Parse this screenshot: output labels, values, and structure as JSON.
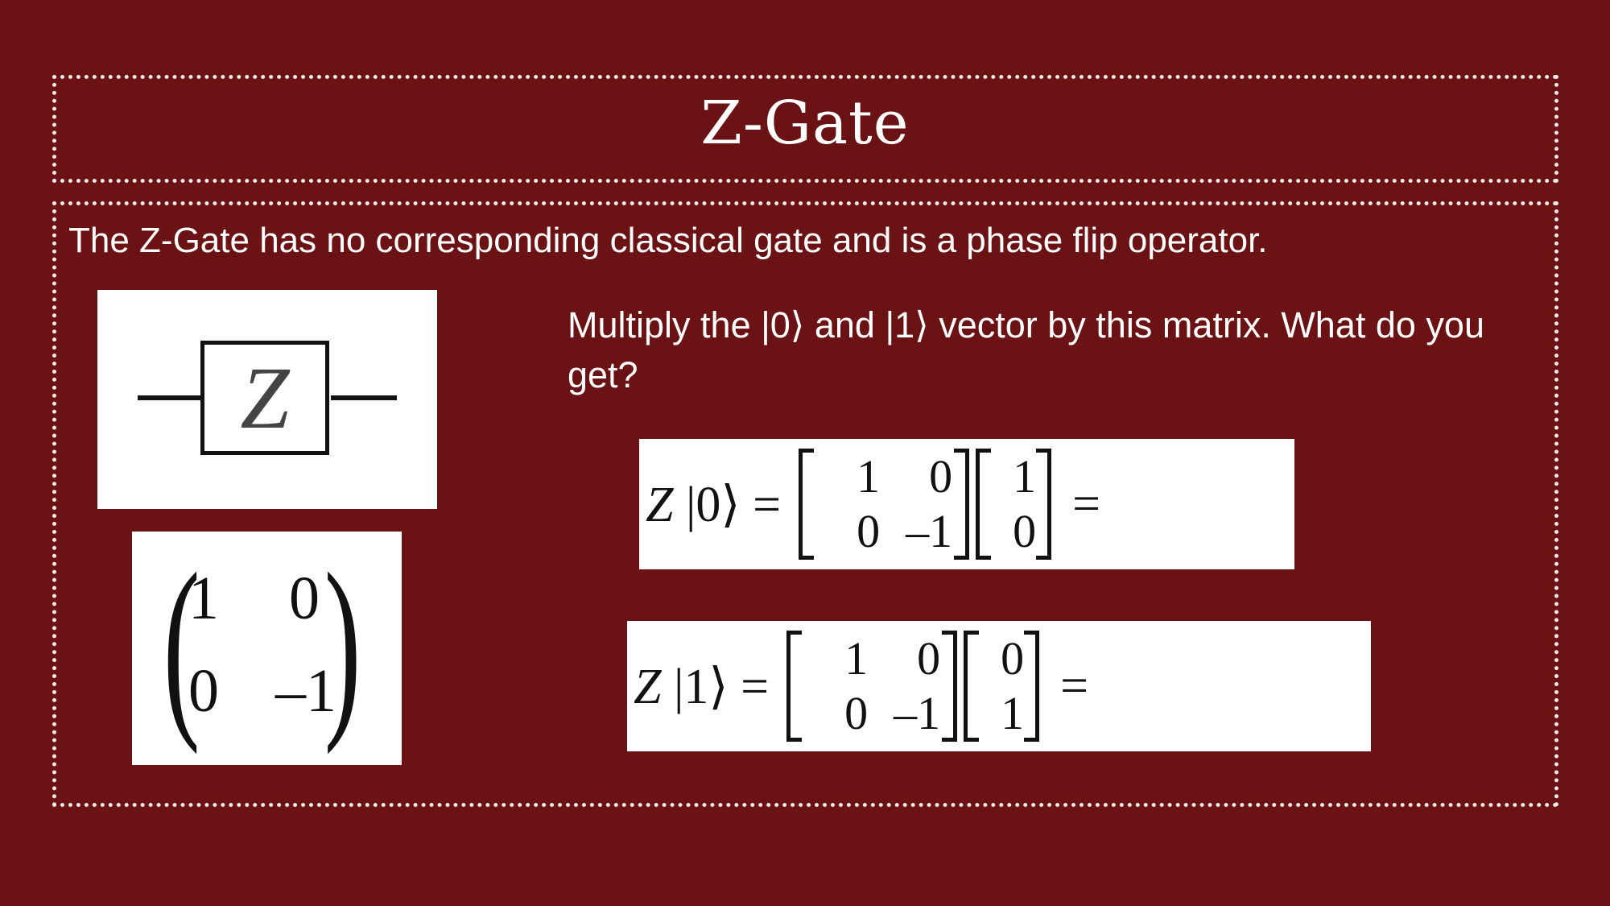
{
  "slide": {
    "title": "Z-Gate",
    "intro": "The Z-Gate has no corresponding classical gate and is a phase flip operator.",
    "question": "Multiply the |0⟩ and  |1⟩ vector by this matrix. What do you get?"
  },
  "gate_diagram": {
    "label": "Z"
  },
  "matrix": {
    "cells": [
      "1",
      "0",
      "0",
      "–1"
    ]
  },
  "equations": [
    {
      "operator": "Z",
      "ket": "|0⟩",
      "equals": "=",
      "matrix": [
        "1",
        "0",
        "0",
        "–1"
      ],
      "vector": [
        "1",
        "0"
      ],
      "result_equals": "="
    },
    {
      "operator": "Z",
      "ket": "|1⟩",
      "equals": "=",
      "matrix": [
        "1",
        "0",
        "0",
        "–1"
      ],
      "vector": [
        "0",
        "1"
      ],
      "result_equals": "="
    }
  ],
  "colors": {
    "background": "#6b1214",
    "frame": "#f3e9e9",
    "text": "#ffffff"
  }
}
